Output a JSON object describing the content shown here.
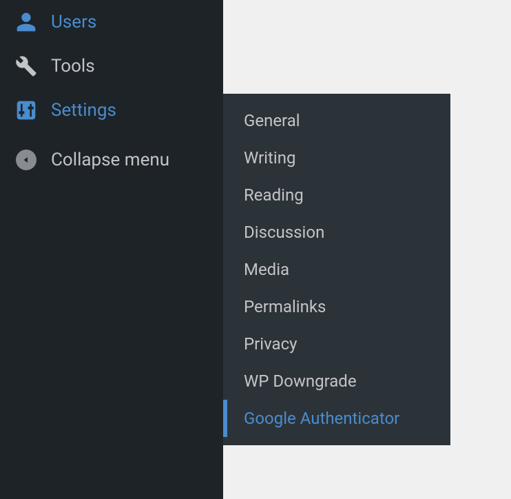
{
  "sidebar": {
    "items": [
      {
        "label": "Users",
        "icon": "user-icon"
      },
      {
        "label": "Tools",
        "icon": "wrench-icon"
      },
      {
        "label": "Settings",
        "icon": "sliders-icon",
        "active": true
      }
    ],
    "collapse_label": "Collapse menu"
  },
  "submenu": {
    "items": [
      {
        "label": "General"
      },
      {
        "label": "Writing"
      },
      {
        "label": "Reading"
      },
      {
        "label": "Discussion"
      },
      {
        "label": "Media"
      },
      {
        "label": "Permalinks"
      },
      {
        "label": "Privacy"
      },
      {
        "label": "WP Downgrade"
      },
      {
        "label": "Google Authenticator",
        "selected": true
      }
    ]
  },
  "colors": {
    "sidebar_bg": "#1d2327",
    "submenu_bg": "#2c3338",
    "text_default": "#c3c4c7",
    "text_active": "#4a8cce"
  }
}
